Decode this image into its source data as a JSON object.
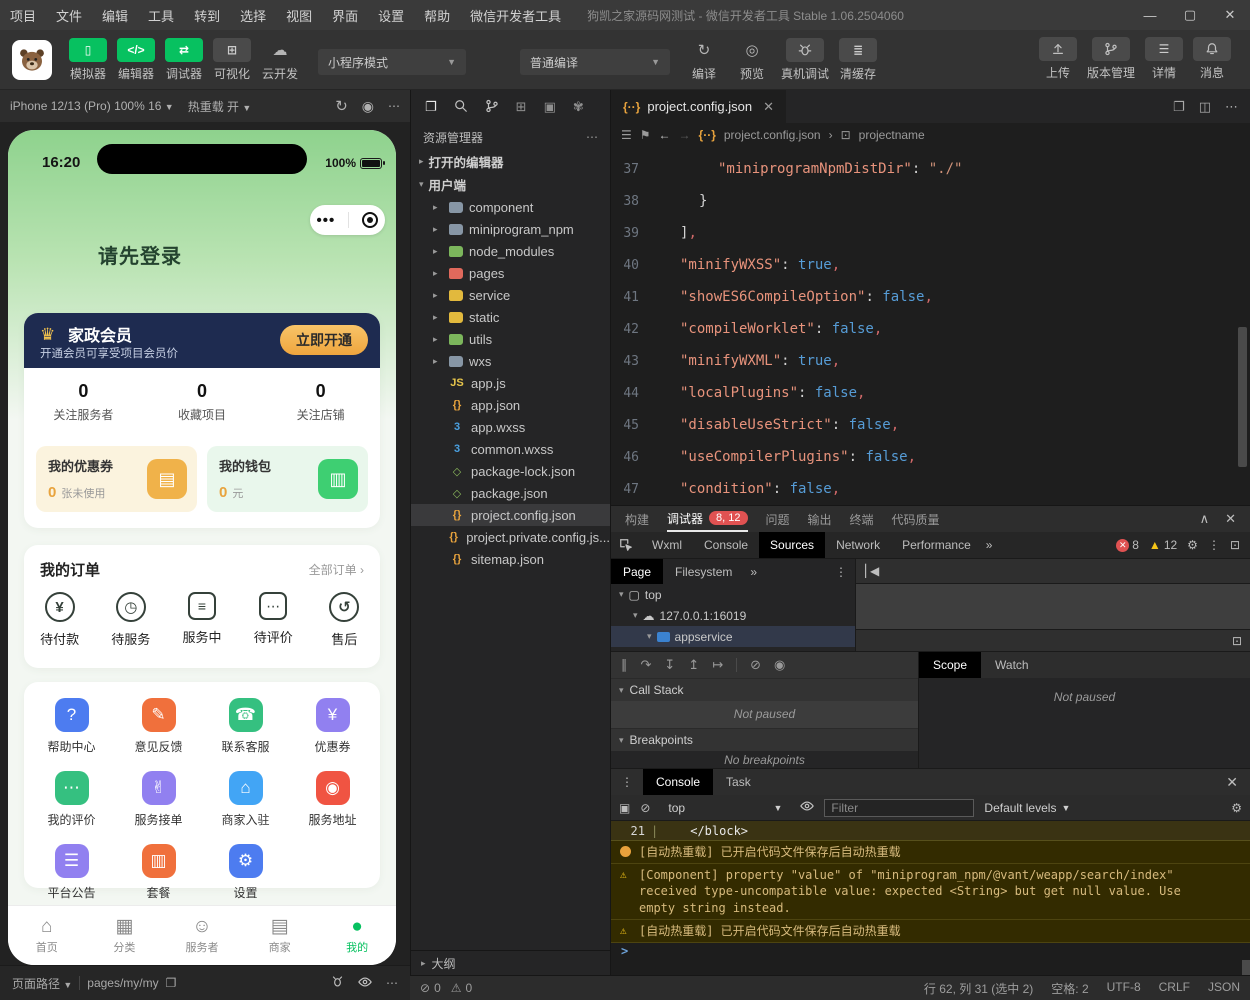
{
  "titlebar": {
    "menus": [
      "项目",
      "文件",
      "编辑",
      "工具",
      "转到",
      "选择",
      "视图",
      "界面",
      "设置",
      "帮助",
      "微信开发者工具"
    ],
    "title": "狗凯之家源码网测试 - 微信开发者工具 Stable 1.06.2504060"
  },
  "toolbar": {
    "tools": [
      {
        "label": "模拟器"
      },
      {
        "label": "编辑器"
      },
      {
        "label": "调试器"
      },
      {
        "label": "可视化"
      },
      {
        "label": "云开发"
      }
    ],
    "mode_select": "小程序模式",
    "compile_select": "普通编译",
    "compile_actions": [
      {
        "label": "编译"
      },
      {
        "label": "预览"
      },
      {
        "label": "真机调试"
      },
      {
        "label": "清缓存"
      }
    ],
    "right_actions": [
      {
        "label": "上传"
      },
      {
        "label": "版本管理"
      },
      {
        "label": "详情"
      },
      {
        "label": "消息"
      }
    ],
    "accent_green": "#07c160"
  },
  "simulator": {
    "device": "iPhone 12/13 (Pro) 100% 16",
    "hot_reload": "热重载 开",
    "time": "16:20",
    "battery": "100%",
    "login_prompt": "请先登录",
    "vip": {
      "title": "家政会员",
      "subtitle": "开通会员可享受项目会员价",
      "button": "立即开通"
    },
    "stats": [
      {
        "value": "0",
        "label": "关注服务者"
      },
      {
        "value": "0",
        "label": "收藏项目"
      },
      {
        "value": "0",
        "label": "关注店铺"
      }
    ],
    "coupon": {
      "title": "我的优惠券",
      "count": "0",
      "suffix": "张未使用"
    },
    "wallet": {
      "title": "我的钱包",
      "count": "0",
      "suffix": "元"
    },
    "orders": {
      "title": "我的订单",
      "more": "全部订单",
      "items": [
        {
          "label": "待付款",
          "glyph": "¥",
          "cls": "circ"
        },
        {
          "label": "待服务",
          "glyph": "◷",
          "cls": "circ"
        },
        {
          "label": "服务中",
          "glyph": "≡",
          "cls": "box"
        },
        {
          "label": "待评价",
          "glyph": "⋯",
          "cls": "box"
        },
        {
          "label": "售后",
          "glyph": "↺",
          "cls": "circ"
        }
      ]
    },
    "grid": [
      {
        "label": "帮助中心",
        "glyph": "?",
        "style": "background:#4d7cf0"
      },
      {
        "label": "意见反馈",
        "glyph": "✎",
        "style": "background:#f0703c"
      },
      {
        "label": "联系客服",
        "glyph": "☎",
        "style": "background:#35c080"
      },
      {
        "label": "优惠券",
        "glyph": "¥",
        "style": "background:#9180f0"
      },
      {
        "label": "我的评价",
        "glyph": "⋯",
        "style": "background:#35c080"
      },
      {
        "label": "服务接单",
        "glyph": "✌",
        "style": "background:#9180f0"
      },
      {
        "label": "商家入驻",
        "glyph": "⌂",
        "style": "background:#42a5f5"
      },
      {
        "label": "服务地址",
        "glyph": "◉",
        "style": "background:#f05442"
      },
      {
        "label": "平台公告",
        "glyph": "☰",
        "style": "background:#9180f0"
      },
      {
        "label": "套餐",
        "glyph": "▥",
        "style": "background:#f0703c"
      },
      {
        "label": "设置",
        "glyph": "⚙",
        "style": "background:#4d7cf0"
      }
    ],
    "tabbar": [
      {
        "label": "首页",
        "glyph": "⌂",
        "cls": ""
      },
      {
        "label": "分类",
        "glyph": "▦",
        "cls": ""
      },
      {
        "label": "服务者",
        "glyph": "☺",
        "cls": ""
      },
      {
        "label": "商家",
        "glyph": "▤",
        "cls": ""
      },
      {
        "label": "我的",
        "glyph": "●",
        "cls": "active"
      }
    ],
    "footer": {
      "path_label": "页面路径",
      "path": "pages/my/my"
    }
  },
  "explorer": {
    "title": "资源管理器",
    "sections": [
      {
        "arrow": "▸",
        "label": "打开的编辑器"
      },
      {
        "arrow": "▾",
        "label": "用户端"
      }
    ],
    "tree": [
      {
        "arrow": "▸",
        "glyph": "",
        "name": "component",
        "icls": "folder",
        "istyle": "background:#8796a5",
        "cls": ""
      },
      {
        "arrow": "▸",
        "glyph": "",
        "name": "miniprogram_npm",
        "icls": "folder",
        "istyle": "background:#8796a5",
        "cls": ""
      },
      {
        "arrow": "▸",
        "glyph": "",
        "name": "node_modules",
        "icls": "folder",
        "istyle": "background:#7cb65c",
        "cls": ""
      },
      {
        "arrow": "▸",
        "glyph": "",
        "name": "pages",
        "icls": "folder",
        "istyle": "background:#e0695c",
        "cls": ""
      },
      {
        "arrow": "▸",
        "glyph": "",
        "name": "service",
        "icls": "folder",
        "istyle": "background:#e2b93d",
        "cls": ""
      },
      {
        "arrow": "▸",
        "glyph": "",
        "name": "static",
        "icls": "folder",
        "istyle": "background:#e2b93d",
        "cls": ""
      },
      {
        "arrow": "▸",
        "glyph": "",
        "name": "utils",
        "icls": "folder",
        "istyle": "background:#7cb65c",
        "cls": ""
      },
      {
        "arrow": "▸",
        "glyph": "",
        "name": "wxs",
        "icls": "folder",
        "istyle": "background:#8796a5",
        "cls": ""
      },
      {
        "arrow": "",
        "glyph": "JS",
        "name": "app.js",
        "icls": "file",
        "istyle": "color:#e8c64b",
        "cls": ""
      },
      {
        "arrow": "",
        "glyph": "{}",
        "name": "app.json",
        "icls": "file",
        "istyle": "color:#e8a33d",
        "cls": ""
      },
      {
        "arrow": "",
        "glyph": "3",
        "name": "app.wxss",
        "icls": "file",
        "istyle": "color:#4aa0e0",
        "cls": ""
      },
      {
        "arrow": "",
        "glyph": "3",
        "name": "common.wxss",
        "icls": "file",
        "istyle": "color:#4aa0e0",
        "cls": ""
      },
      {
        "arrow": "",
        "glyph": "◇",
        "name": "package-lock.json",
        "icls": "file",
        "istyle": "color:#8ab85c",
        "cls": ""
      },
      {
        "arrow": "",
        "glyph": "◇",
        "name": "package.json",
        "icls": "file",
        "istyle": "color:#8ab85c",
        "cls": ""
      },
      {
        "arrow": "",
        "glyph": "{}",
        "name": "project.config.json",
        "icls": "file",
        "istyle": "color:#e8a33d",
        "cls": "selected"
      },
      {
        "arrow": "",
        "glyph": "{}",
        "name": "project.private.config.js...",
        "icls": "file",
        "istyle": "color:#e8a33d",
        "cls": ""
      },
      {
        "arrow": "",
        "glyph": "{}",
        "name": "sitemap.json",
        "icls": "file",
        "istyle": "color:#e8a33d",
        "cls": ""
      }
    ],
    "outline": "大纲"
  },
  "editor": {
    "tab": "project.config.json",
    "breadcrumb_file": "project.config.json",
    "breadcrumb_symbol": "projectname",
    "lines": [
      {
        "num": "37",
        "cls": "ind3",
        "key": "\"miniprogramNpmDistDir\"",
        "sep": ": ",
        "val": "\"./\"",
        "vcls": "str",
        "comma": ""
      },
      {
        "num": "38",
        "cls": "ind2",
        "key": "",
        "sep": "",
        "val": "}",
        "vcls": "p",
        "comma": ""
      },
      {
        "num": "39",
        "cls": "ind1",
        "key": "",
        "sep": "",
        "val": "]",
        "vcls": "p",
        "comma": ","
      },
      {
        "num": "40",
        "cls": "ind1",
        "key": "\"minifyWXSS\"",
        "sep": ": ",
        "val": "true",
        "vcls": "bool",
        "comma": ","
      },
      {
        "num": "41",
        "cls": "ind1",
        "key": "\"showES6CompileOption\"",
        "sep": ": ",
        "val": "false",
        "vcls": "bool",
        "comma": ","
      },
      {
        "num": "42",
        "cls": "ind1",
        "key": "\"compileWorklet\"",
        "sep": ": ",
        "val": "false",
        "vcls": "bool",
        "comma": ","
      },
      {
        "num": "43",
        "cls": "ind1",
        "key": "\"minifyWXML\"",
        "sep": ": ",
        "val": "true",
        "vcls": "bool",
        "comma": ","
      },
      {
        "num": "44",
        "cls": "ind1",
        "key": "\"localPlugins\"",
        "sep": ": ",
        "val": "false",
        "vcls": "bool",
        "comma": ","
      },
      {
        "num": "45",
        "cls": "ind1",
        "key": "\"disableUseStrict\"",
        "sep": ": ",
        "val": "false",
        "vcls": "bool",
        "comma": ","
      },
      {
        "num": "46",
        "cls": "ind1",
        "key": "\"useCompilerPlugins\"",
        "sep": ": ",
        "val": "false",
        "vcls": "bool",
        "comma": ","
      },
      {
        "num": "47",
        "cls": "ind1",
        "key": "\"condition\"",
        "sep": ": ",
        "val": "false",
        "vcls": "bool",
        "comma": ","
      }
    ]
  },
  "debug": {
    "panel_tabs": [
      {
        "label": "构建",
        "cls": "",
        "badge": ""
      },
      {
        "label": "调试器",
        "cls": "active",
        "badge": "8, 12"
      },
      {
        "label": "问题",
        "cls": "",
        "badge": ""
      },
      {
        "label": "输出",
        "cls": "",
        "badge": ""
      },
      {
        "label": "终端",
        "cls": "",
        "badge": ""
      },
      {
        "label": "代码质量",
        "cls": "",
        "badge": ""
      }
    ],
    "devtools_tabs": [
      {
        "label": "Wxml",
        "cls": ""
      },
      {
        "label": "Console",
        "cls": ""
      },
      {
        "label": "Sources",
        "cls": "active"
      },
      {
        "label": "Network",
        "cls": ""
      },
      {
        "label": "Performance",
        "cls": ""
      }
    ],
    "error_count": "8",
    "warning_count": "12",
    "source_tabs": [
      {
        "label": "Page",
        "cls": "active"
      },
      {
        "label": "Filesystem",
        "cls": ""
      }
    ],
    "tree": [
      {
        "name": "top"
      },
      {
        "name": "127.0.0.1:16019"
      },
      {
        "name": "appservice"
      }
    ],
    "callstack_title": "Call Stack",
    "callstack_empty": "Not paused",
    "breakpoints_title": "Breakpoints",
    "breakpoints_empty": "No breakpoints",
    "scope_tabs": [
      {
        "label": "Scope",
        "cls": "active"
      },
      {
        "label": "Watch",
        "cls": ""
      }
    ],
    "scope_empty": "Not paused",
    "console": {
      "tabs": [
        {
          "label": "Console",
          "cls": "active"
        },
        {
          "label": "Task",
          "cls": ""
        }
      ],
      "context": "top",
      "filter_placeholder": "Filter",
      "levels": "Default levels",
      "code_line": {
        "num": "21",
        "text": "</block>"
      },
      "messages": [
        {
          "icls": "dot",
          "glyph": "",
          "text": "[自动热重载] 已开启代码文件保存后自动热重载"
        },
        {
          "icls": "warn",
          "glyph": "⚠",
          "text": "[Component] property \"value\" of \"miniprogram_npm/@vant/weapp/search/index\" received type-uncompatible value: expected <String> but get null value. Use empty string instead."
        },
        {
          "icls": "warn",
          "glyph": "⚠",
          "text": "[自动热重载] 已开启代码文件保存后自动热重载"
        }
      ],
      "prompt": ">"
    }
  },
  "statusbar": {
    "errors": "0",
    "warnings": "0",
    "items": [
      "行 62, 列 31 (选中 2)",
      "空格: 2",
      "UTF-8",
      "CRLF",
      "JSON"
    ]
  }
}
